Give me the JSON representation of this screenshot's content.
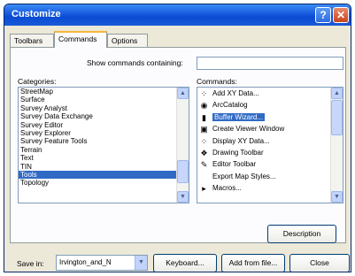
{
  "window": {
    "title": "Customize",
    "help_glyph": "?",
    "close_glyph": "✕"
  },
  "tabs": [
    {
      "label": "Toolbars",
      "active": false
    },
    {
      "label": "Commands",
      "active": true
    },
    {
      "label": "Options",
      "active": false
    }
  ],
  "search": {
    "label": "Show commands containing:",
    "value": ""
  },
  "categories": {
    "label": "Categories:",
    "selected": "Tools",
    "items": [
      "StreetMap",
      "Surface",
      "Survey Analyst",
      "Survey Data Exchange",
      "Survey Editor",
      "Survey Explorer",
      "Survey Feature Tools",
      "Terrain",
      "Text",
      "TIN",
      "Tools",
      "Topology"
    ]
  },
  "commands": {
    "label": "Commands:",
    "selected": "Buffer Wizard...",
    "items": [
      {
        "label": "Add XY Data...",
        "icon": "xy-data-icon",
        "glyph": "⁘"
      },
      {
        "label": "ArcCatalog",
        "icon": "arccatalog-icon",
        "glyph": "◉"
      },
      {
        "label": "Buffer Wizard...",
        "icon": "buffer-icon",
        "glyph": "▮"
      },
      {
        "label": "Create Viewer Window",
        "icon": "viewer-window-icon",
        "glyph": "▣"
      },
      {
        "label": "Display XY Data...",
        "icon": "display-xy-icon",
        "glyph": "⁘"
      },
      {
        "label": "Drawing Toolbar",
        "icon": "drawing-toolbar-icon",
        "glyph": "❖"
      },
      {
        "label": "Editor Toolbar",
        "icon": "editor-toolbar-icon",
        "glyph": "✎"
      },
      {
        "label": "Export Map Styles...",
        "icon": "",
        "glyph": ""
      },
      {
        "label": "Macros...",
        "icon": "macros-arrow-icon",
        "glyph": "▸"
      }
    ]
  },
  "buttons": {
    "description": "Description",
    "keyboard": "Keyboard...",
    "add_from_file": "Add from file...",
    "close": "Close"
  },
  "save_in": {
    "label": "Save in:",
    "value": "Irvington_and_N"
  },
  "colors": {
    "title_bar": "#0a4bd3",
    "selection": "#316ac5",
    "dialog_bg": "#ece9d8"
  }
}
